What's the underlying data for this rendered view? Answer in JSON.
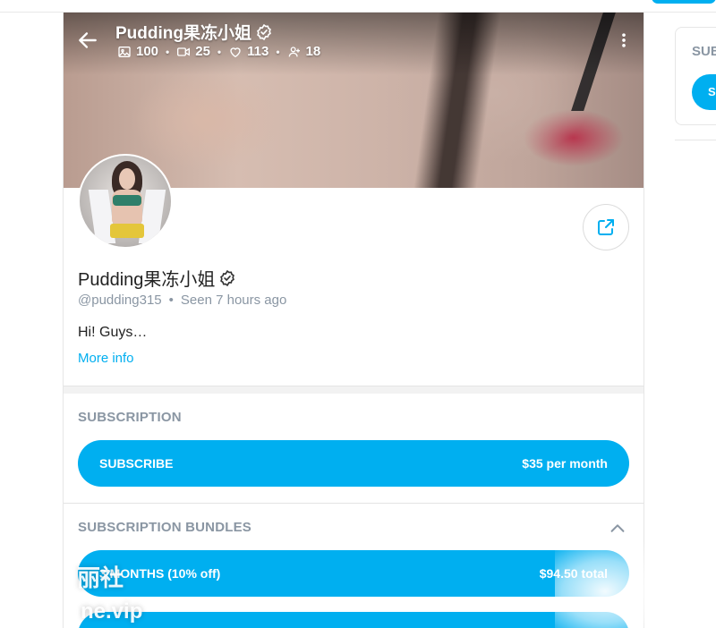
{
  "cover": {
    "name": "Pudding果冻小姐",
    "stats": {
      "photos": "100",
      "videos": "25",
      "likes": "113",
      "fans": "18"
    }
  },
  "profile": {
    "name": "Pudding果冻小姐",
    "handle": "@pudding315",
    "dot": "•",
    "last_seen": "Seen  7 hours ago",
    "bio": "Hi! Guys…",
    "more_info": "More info"
  },
  "subscription": {
    "label": "SUBSCRIPTION",
    "button_label": "SUBSCRIBE",
    "price": "$35 per month"
  },
  "bundles": {
    "label": "SUBSCRIPTION BUNDLES",
    "items": [
      {
        "label": "3 MONTHS (10% off)",
        "price": "$94.50 total"
      }
    ]
  },
  "right_panel": {
    "label": "SUB",
    "button_label": "S"
  },
  "watermark": {
    "line1": "丽社",
    "line2": "ne.vip"
  },
  "colors": {
    "accent": "#00aff0",
    "muted": "#8a96a3",
    "text": "#222222"
  },
  "icons": [
    "back-arrow-icon",
    "verified-icon",
    "image-icon",
    "video-icon",
    "heart-icon",
    "fans-icon",
    "more-vertical-icon",
    "share-icon",
    "chevron-up-icon"
  ]
}
